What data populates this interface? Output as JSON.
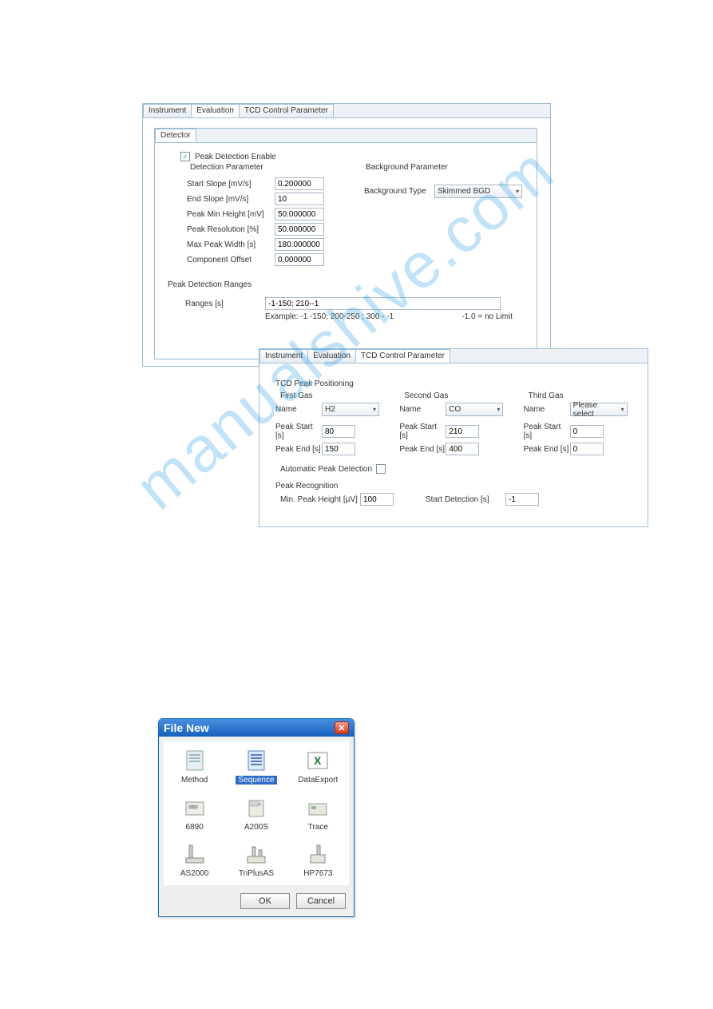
{
  "watermark": "manualshive.com",
  "panel1": {
    "tabs": [
      "Instrument",
      "Evaluation",
      "TCD Control Parameter"
    ],
    "active_tab": 1,
    "inner_tab": "Detector",
    "checkbox_label": "Peak Detection Enable",
    "checkbox_checked": true,
    "detection_group": "Detection Parameter",
    "background_group": "Background Parameter",
    "bg_type_label": "Background Type",
    "bg_type_value": "Skimmed BGD",
    "params": [
      {
        "label": "Start Slope [mV/s]",
        "value": "0.200000"
      },
      {
        "label": "End Slope [mV/s]",
        "value": "10"
      },
      {
        "label": "Peak Min Height [mV]",
        "value": "50.000000"
      },
      {
        "label": "Peak Resolution [%]",
        "value": "50.000000"
      },
      {
        "label": "Max Peak Width [s]",
        "value": "180.000000"
      },
      {
        "label": "Component Offset",
        "value": "0.000000"
      }
    ],
    "ranges_group": "Peak Detection Ranges",
    "ranges_label": "Ranges [s]",
    "ranges_value": "-1-150; 210--1",
    "example_text": "Example:  -1 -150;  200-250 ;  300 - -1",
    "nolimit_text": "-1.0 = no Limit"
  },
  "panel2": {
    "tabs": [
      "Instrument",
      "Evaluation",
      "TCD Control Parameter"
    ],
    "active_tab": 2,
    "peak_pos_group": "TCD Peak Positioning",
    "gases": [
      {
        "heading": "First Gas",
        "name_label": "Name",
        "name": "H2",
        "start_label": "Peak Start [s]",
        "start": "80",
        "end_label": "Peak End  [s]",
        "end": "150"
      },
      {
        "heading": "Second Gas",
        "name_label": "Name",
        "name": "CO",
        "start_label": "Peak Start [s]",
        "start": "210",
        "end_label": "Peak End  [s]",
        "end": "400"
      },
      {
        "heading": "Third Gas",
        "name_label": "Name",
        "name": "Please select",
        "start_label": "Peak Start [s]",
        "start": "0",
        "end_label": "Peak End  [s]",
        "end": "0"
      }
    ],
    "auto_label": "Automatic Peak Detection",
    "auto_checked": false,
    "recog_group": "Peak Recognition",
    "min_height_label": "Min. Peak Height [µV]",
    "min_height_value": "100",
    "start_det_label": "Start Detection  [s]",
    "start_det_value": "-1"
  },
  "filenew": {
    "title": "File New",
    "items": [
      "Method",
      "Sequence",
      "DataExport",
      "6890",
      "A200S",
      "Trace",
      "AS2000",
      "TriPlusAS",
      "HP7673"
    ],
    "selected": 1,
    "ok": "OK",
    "cancel": "Cancel"
  }
}
